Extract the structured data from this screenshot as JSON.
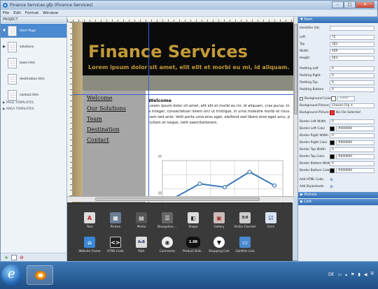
{
  "window": {
    "title": "Finance Services.gfp (Finance Services)"
  },
  "menu": [
    "File",
    "Edit",
    "Format",
    "Window"
  ],
  "project": {
    "header": "PROJECT",
    "pages": [
      {
        "label": "Start Page",
        "selected": true
      },
      {
        "label": "solutions",
        "selected": false
      },
      {
        "label": "team.htm",
        "selected": false
      },
      {
        "label": "destination.htm",
        "selected": false
      },
      {
        "label": "contact.htm",
        "selected": false
      }
    ],
    "sections": [
      "PAGE TEMPLATES",
      "AREA TEMPLATES"
    ]
  },
  "site": {
    "title": "Finance Services",
    "tagline": "Lorem ipsum dolor sit amet, elit elit et morbi eu mi, id aliquam.",
    "nav": [
      "Welcome",
      "Our Solutions",
      "Team",
      "Destination",
      "Contact"
    ],
    "welcome_heading": "Welcome",
    "welcome_text": "Lorem ipsum dolor sit amet, elit elit et morbi eu mi, id aliquam, cras purus. In\na integer, consectetuer lorem orci ut tristique, in urna molestie morbi et risus.\nnam sed ante. Velit porta urna eros eget, eleifend sed libero eros eget arcu, p\nnullam et neque, velit exercitationem."
  },
  "chart_data": {
    "type": "line",
    "x": [
      1,
      2,
      3,
      4,
      5
    ],
    "values": [
      1,
      2.6,
      2.2,
      4,
      2.4
    ],
    "ylim": [
      0,
      5
    ],
    "grid": true
  },
  "toolbox": {
    "row1": [
      "Text",
      "Picture",
      "Media",
      "Navigation ...",
      "Shape",
      "Gallery",
      "Visitor Counter",
      "Form"
    ],
    "row2": [
      "Website Frame",
      "HTML Code",
      "Path",
      "Comments",
      "Product Butt...",
      "Shopping Cart",
      "Goldfish Link"
    ],
    "product_badge": "1.00"
  },
  "inspector": {
    "item_header": "Item",
    "identifier_label": "Identifier (Id)",
    "identifier_value": "",
    "left_label": "Left",
    "left": "72",
    "top_label": "Top",
    "top": "183",
    "width_label": "Width",
    "width": "409",
    "height_label": "Height",
    "height": "263",
    "padding_left_label": "Padding Left",
    "padding_left": "0",
    "padding_right_label": "Padding Right",
    "padding_right": "0",
    "padding_top_label": "Padding Top",
    "padding_top": "0",
    "padding_bottom_label": "Padding Bottom",
    "padding_bottom": "0",
    "bg_color_label": "Background Color",
    "bg_color_value": "#ffffff",
    "bg_picture_label": "Background Picture...",
    "bg_picture_option": "Choose Clip",
    "bg_picture_label2": "Background Picture",
    "bg_picture_state": "No File Selected",
    "border_left_width_label": "Border Left Width",
    "border_left_width": "0",
    "border_left_color_label": "Border Left Color",
    "border_left_color": "#000000",
    "border_right_width_label": "Border Right Width",
    "border_right_width": "0",
    "border_right_color_label": "Border Right Color",
    "border_right_color": "#000000",
    "border_top_width_label": "Border Top Width",
    "border_top_width": "0",
    "border_top_color_label": "Border Top Color",
    "border_top_color": "#000000",
    "border_bottom_width_label": "Border Bottom Width",
    "border_bottom_width": "0",
    "border_bottom_color_label": "Border Bottom Color",
    "border_bottom_color": "#000000",
    "add_html_label": "Add HTML Code",
    "add_stylesheets_label": "Add Stylesheets",
    "picture_header": "Picture",
    "link_header": "Link"
  },
  "taskbar": {
    "language": "DE"
  },
  "colors": {
    "brand_gold": "#c39a3a",
    "header_black": "#0b0b0b",
    "accent_blue": "#3a77c0",
    "chart_line": "#3b78b8"
  }
}
